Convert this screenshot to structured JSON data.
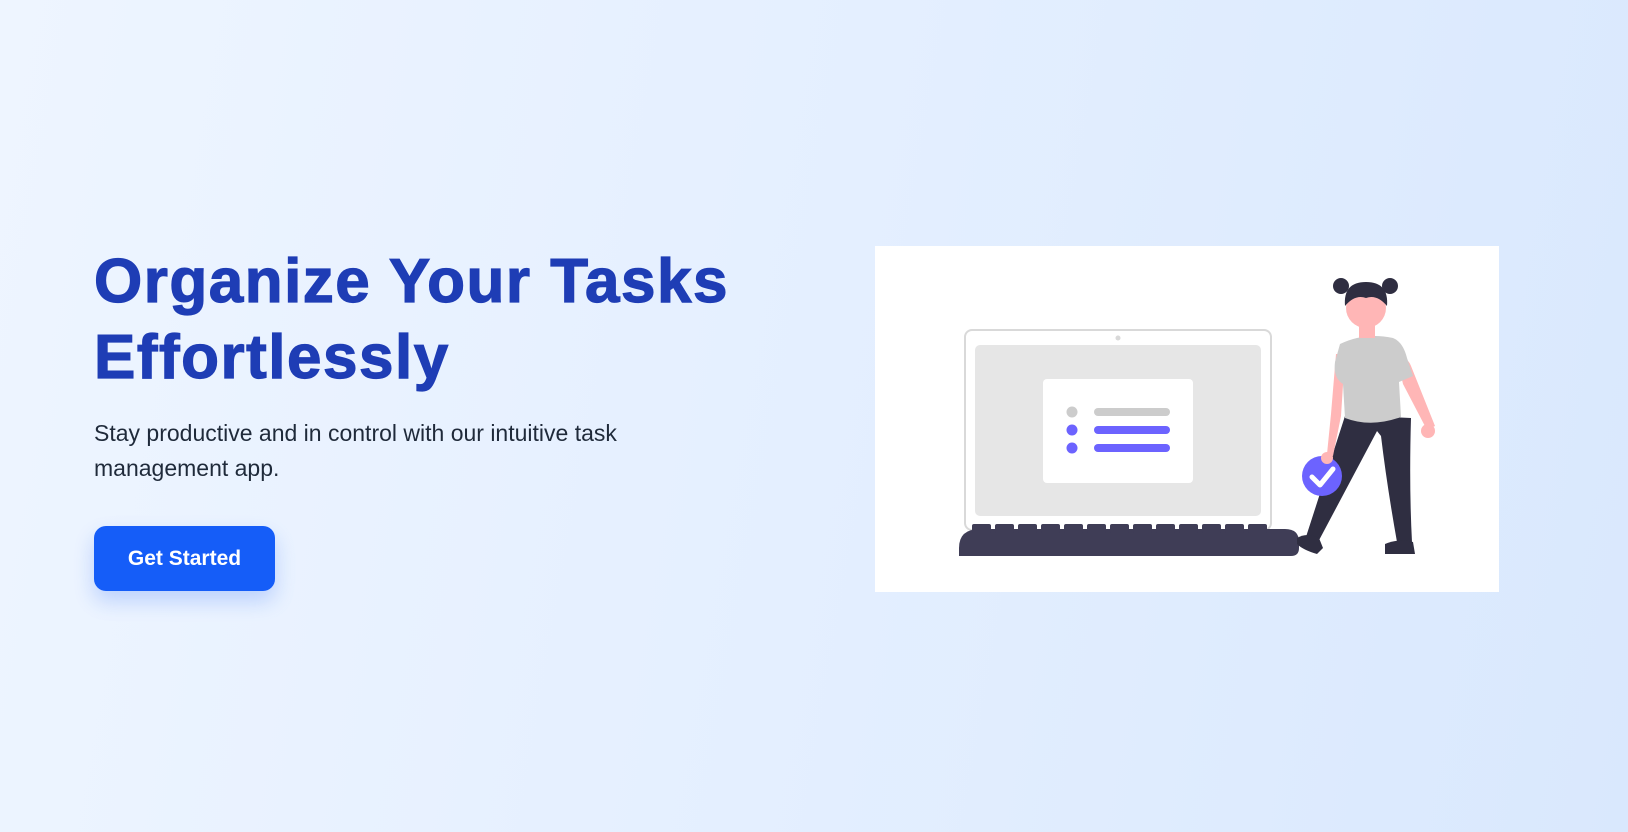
{
  "hero": {
    "headline_line1": "Organize Your Tasks",
    "headline_line2": "Effortlessly",
    "subtitle": "Stay productive and in control with our intuitive task management app.",
    "cta_label": "Get Started"
  },
  "illustration": {
    "icon": "person-with-laptop-task-list-icon",
    "accent_color": "#6c63ff",
    "dark_color": "#3f3d56"
  },
  "colors": {
    "headline": "#1e3db5",
    "button": "#155df8",
    "text": "#1f2a3a"
  }
}
